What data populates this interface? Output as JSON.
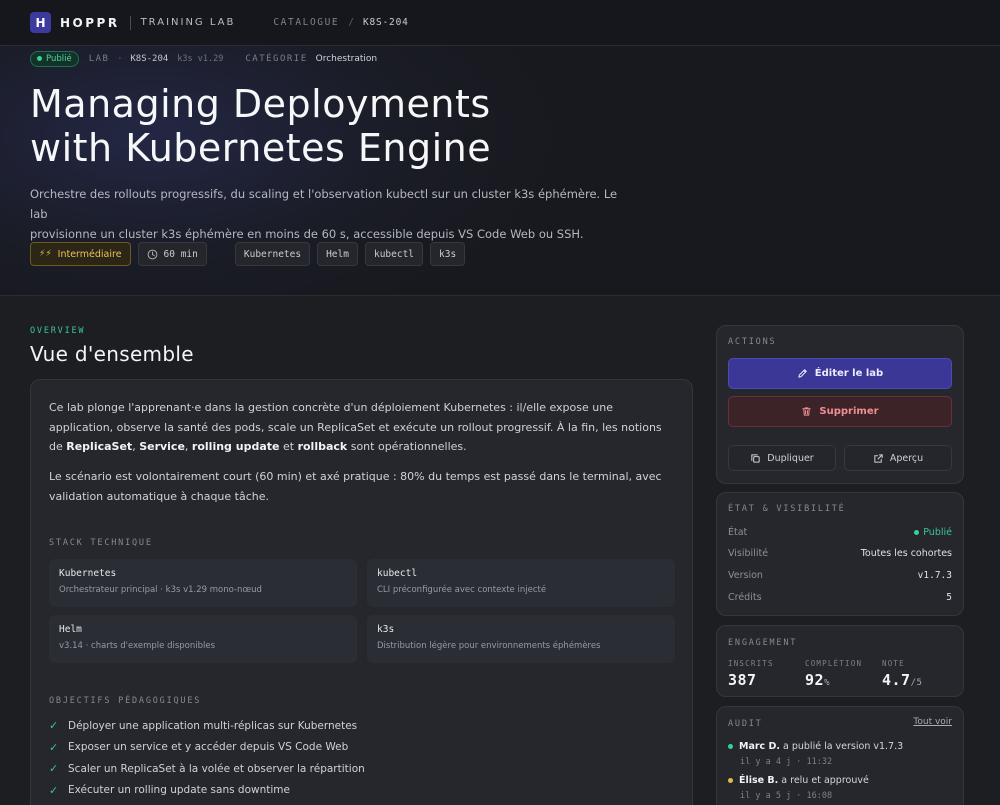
{
  "topbar": {
    "logo_letter": "H",
    "brand": "HOPPR",
    "brand_sub": "TRAINING LAB",
    "crumb_catalogue": "CATALOGUE",
    "crumb_sep": "/",
    "crumb_current": "K8S-204"
  },
  "meta": {
    "status": "Publié",
    "lab_label": "LAB",
    "dot": "·",
    "code": "K8S-204",
    "version": "k3s v1.29",
    "category_label": "CATÉGORIE",
    "category": "Orchestration"
  },
  "hero": {
    "title_line1": "Managing Deployments",
    "title_line2": "with Kubernetes Engine",
    "desc_line1": "Orchestre des rollouts progressifs, du scaling et l'observation kubectl sur un cluster k3s éphémère. Le lab",
    "desc_line2": "provisionne un cluster k3s éphémère en moins de 60 s, accessible depuis VS Code Web ou SSH.",
    "level": "Intermédiaire",
    "duration": "60 min",
    "tags": [
      "Kubernetes",
      "Helm",
      "kubectl",
      "k3s"
    ]
  },
  "overview": {
    "eyebrow": "OVERVIEW",
    "title": "Vue d'ensemble",
    "p1_a": "Ce lab plonge l'apprenant·e dans la gestion concrète d'un déploiement Kubernetes : il/elle expose une application, observe la santé des pods, scale un ReplicaSet et exécute un rollout progressif. À la fin, les notions de ",
    "p1_b1": "ReplicaSet",
    "p1_c1": ", ",
    "p1_b2": "Service",
    "p1_c2": ", ",
    "p1_b3": "rolling update",
    "p1_c3": " et ",
    "p1_b4": "rollback",
    "p1_d": " sont opérationnelles.",
    "p2": "Le scénario est volontairement court (60 min) et axé pratique : 80% du temps est passé dans le terminal, avec validation automatique à chaque tâche.",
    "stack_label": "STACK TECHNIQUE",
    "stack": [
      {
        "name": "Kubernetes",
        "desc": "Orchestrateur principal · k3s v1.29 mono-nœud"
      },
      {
        "name": "kubectl",
        "desc": "CLI préconfigurée avec contexte injecté"
      },
      {
        "name": "Helm",
        "desc": "v3.14 · charts d'exemple disponibles"
      },
      {
        "name": "k3s",
        "desc": "Distribution légère pour environnements éphémères"
      }
    ],
    "objectives_label": "OBJECTIFS PÉDAGOGIQUES",
    "objectives": [
      "Déployer une application multi-réplicas sur Kubernetes",
      "Exposer un service et y accéder depuis VS Code Web",
      "Scaler un ReplicaSet à la volée et observer la répartition",
      "Exécuter un rolling update sans downtime"
    ]
  },
  "actions": {
    "label": "ACTIONS",
    "edit": "Éditer le lab",
    "delete": "Supprimer",
    "duplicate": "Dupliquer",
    "preview": "Aperçu"
  },
  "state": {
    "label": "ÉTAT & VISIBILITÉ",
    "rows": [
      {
        "k": "État",
        "v": "Publié"
      },
      {
        "k": "Visibilité",
        "v": "Toutes les cohortes"
      },
      {
        "k": "Version",
        "v": "v1.7.3"
      },
      {
        "k": "Crédits",
        "v": "5"
      }
    ]
  },
  "engagement": {
    "label": "ENGAGEMENT",
    "enrolled_label": "INSCRITS",
    "enrolled": "387",
    "completion_label": "COMPLÉTION",
    "completion": "92",
    "completion_unit": "%",
    "rating_label": "NOTE",
    "rating": "4.7",
    "rating_unit": "/5"
  },
  "audit": {
    "label": "AUDIT",
    "see_all": "Tout voir",
    "entries": [
      {
        "who": "Marc D.",
        "action": " a publié la version v1.7.3",
        "time": "il y a 4 j · 11:32",
        "color": "#35d29a"
      },
      {
        "who": "Élise B.",
        "action": " a relu et approuvé",
        "time": "il y a 5 j · 16:08",
        "color": "#e8b84a"
      }
    ]
  }
}
